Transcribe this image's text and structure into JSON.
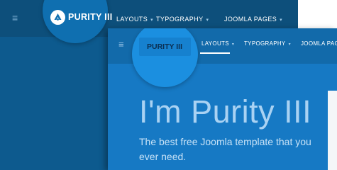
{
  "back_nav": {
    "brand": "PURITY III",
    "menu": [
      {
        "label": "LAYOUTS",
        "caret": "▾"
      },
      {
        "label": "TYPOGRAPHY",
        "caret": "▾"
      },
      {
        "label": "JOOMLA PAGES",
        "caret": "▾"
      }
    ],
    "hamburger": "≡"
  },
  "front_nav": {
    "brand": "PURITY III",
    "menu": [
      {
        "label": "LAYOUTS",
        "caret": "▾"
      },
      {
        "label": "TYPOGRAPHY",
        "caret": "▾"
      },
      {
        "label": "JOOMLA PAGE",
        "caret": ""
      }
    ],
    "hamburger": "≡"
  },
  "hero": {
    "title": "I'm Purity III",
    "text": "The best free Joomla template that you ever need."
  },
  "colors": {
    "back_bg": "#0d5a8e",
    "front_bg": "#1679c4",
    "accent": "#1b8fe0"
  }
}
